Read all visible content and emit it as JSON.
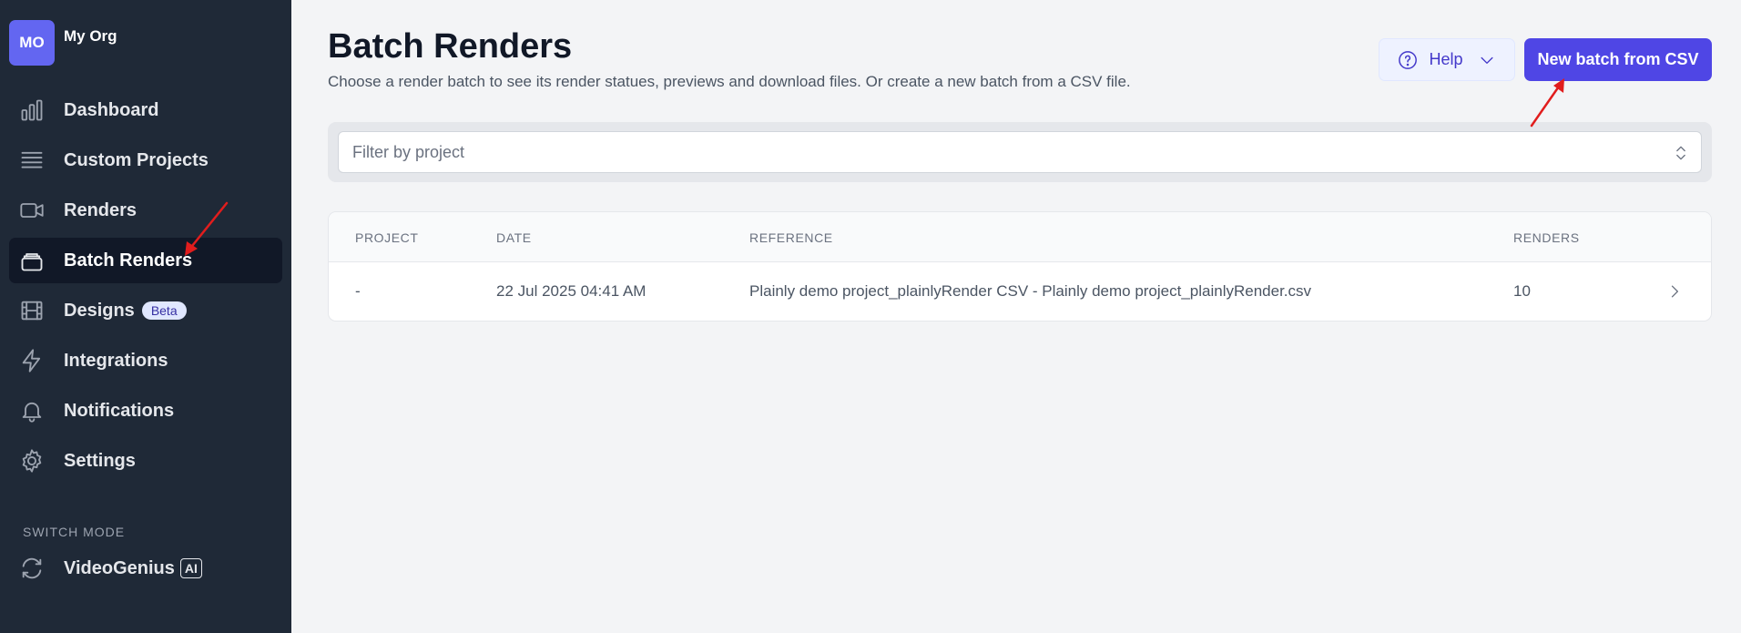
{
  "org": {
    "initials": "MO",
    "name": "My Org"
  },
  "nav": [
    {
      "label": "Dashboard",
      "icon": "chart-bar-icon"
    },
    {
      "label": "Custom Projects",
      "icon": "list-icon"
    },
    {
      "label": "Renders",
      "icon": "video-camera-icon"
    },
    {
      "label": "Batch Renders",
      "icon": "stack-icon",
      "active": true
    },
    {
      "label": "Designs",
      "icon": "film-icon",
      "badge": "Beta"
    },
    {
      "label": "Integrations",
      "icon": "bolt-icon"
    },
    {
      "label": "Notifications",
      "icon": "bell-icon"
    },
    {
      "label": "Settings",
      "icon": "gear-icon"
    }
  ],
  "switch_mode": {
    "label": "SWITCH MODE",
    "item": "VideoGenius",
    "badge": "AI",
    "icon": "refresh-icon"
  },
  "header": {
    "title": "Batch Renders",
    "subtitle": "Choose a render batch to see its render statues, previews and download files. Or create a new batch from a CSV file.",
    "help_label": "Help",
    "new_batch_label": "New batch from CSV"
  },
  "filter": {
    "placeholder": "Filter by project"
  },
  "table": {
    "columns": [
      "PROJECT",
      "DATE",
      "REFERENCE",
      "RENDERS"
    ],
    "rows": [
      {
        "project": "-",
        "date": "22 Jul 2025 04:41 AM",
        "reference": "Plainly demo project_plainlyRender CSV - Plainly demo project_plainlyRender.csv",
        "renders": "10"
      }
    ]
  },
  "colors": {
    "sidebar": "#1f2937",
    "accent": "#4f46e5",
    "annotation": "#e11d1d"
  }
}
